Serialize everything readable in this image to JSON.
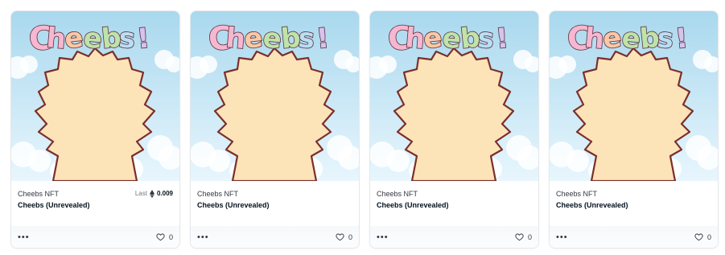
{
  "cards": [
    {
      "collection": "Cheebs NFT",
      "name": "Cheebs (Unrevealed)",
      "art_text": "Cheebs!",
      "last_label": "Last",
      "last_price": "0.009",
      "currency_icon": "ethereum-icon",
      "more_icon": "more-icon",
      "likes": "0"
    },
    {
      "collection": "Cheebs NFT",
      "name": "Cheebs (Unrevealed)",
      "art_text": "Cheebs!",
      "currency_icon": "ethereum-icon",
      "more_icon": "more-icon",
      "likes": "0"
    },
    {
      "collection": "Cheebs NFT",
      "name": "Cheebs (Unrevealed)",
      "art_text": "Cheebs!",
      "currency_icon": "ethereum-icon",
      "more_icon": "more-icon",
      "likes": "0"
    },
    {
      "collection": "Cheebs NFT",
      "name": "Cheebs (Unrevealed)",
      "art_text": "Cheebs!",
      "currency_icon": "ethereum-icon",
      "more_icon": "more-icon",
      "likes": "0"
    }
  ],
  "colors": {
    "sky_top": "#a9d8ee",
    "sky_bottom": "#e8f6fd",
    "cloud": "#ffffff",
    "creature_fill": "#fde3b8",
    "creature_outline": "#7b2f2b",
    "letter_pink": "#f7b7d0",
    "letter_orange": "#fbc8a5",
    "letter_green": "#bfe3a8",
    "letter_blue": "#b9dff5",
    "letter_purple": "#d6c3ee",
    "text_outline": "#5b2f3a"
  }
}
